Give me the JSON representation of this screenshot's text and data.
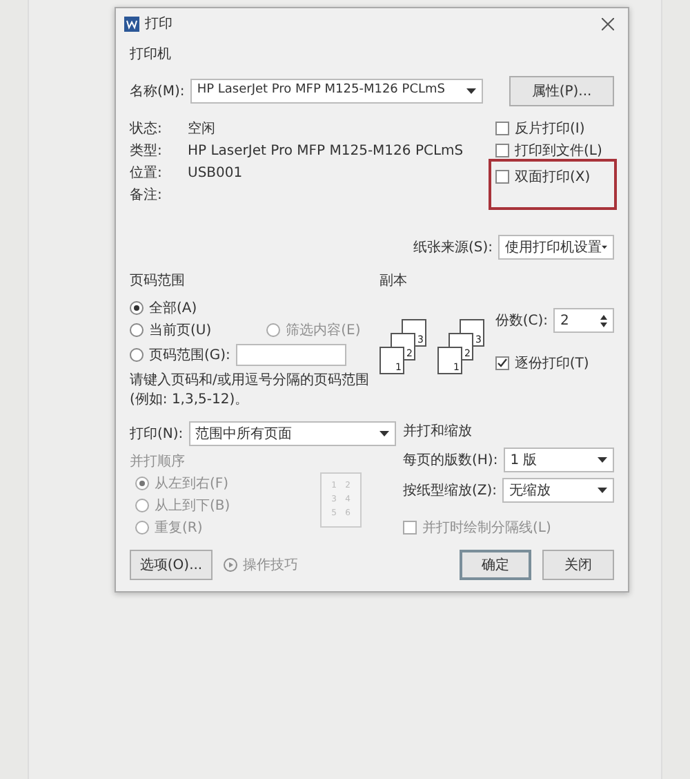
{
  "window": {
    "title": "打印"
  },
  "printer": {
    "heading": "打印机",
    "name_label": "名称(M):",
    "name_value": "HP LaserJet Pro MFP M125-M126 PCLmS",
    "properties_button": "属性(P)...",
    "info": [
      {
        "label": "状态:",
        "value": "空闲"
      },
      {
        "label": "类型:",
        "value": "HP LaserJet Pro MFP M125-M126 PCLmS"
      },
      {
        "label": "位置:",
        "value": "USB001"
      },
      {
        "label": "备注:"
      }
    ],
    "options": [
      {
        "label": "反片打印(I)",
        "checked": false,
        "highlighted": false
      },
      {
        "label": "打印到文件(L)",
        "checked": false,
        "highlighted": false
      },
      {
        "label": "双面打印(X)",
        "checked": false,
        "highlighted": true
      }
    ]
  },
  "paper_source": {
    "label": "纸张来源(S):",
    "value": "使用打印机设置"
  },
  "page_range": {
    "heading": "页码范围",
    "options": [
      {
        "kind": "radio",
        "label": "全部(A)",
        "selected": true,
        "disabled": false
      },
      {
        "kind": "radio",
        "label": "当前页(U)",
        "selected": false,
        "disabled": false
      },
      {
        "kind": "radio",
        "label": "筛选内容(E)",
        "selected": false,
        "disabled": true
      },
      {
        "kind": "input",
        "label": "页码范围(G):",
        "selected": false,
        "disabled": false
      }
    ],
    "hint": "请键入页码和/或用逗号分隔的页码范围(例如: 1,3,5-12)。"
  },
  "copies": {
    "heading": "副本",
    "stacks": [
      {
        "pages": [
          "1",
          "2",
          "3"
        ]
      },
      {
        "pages": [
          "1",
          "2",
          "3"
        ]
      }
    ],
    "count_label": "份数(C):",
    "count_value": "2",
    "collate": {
      "label": "逐份打印(T)",
      "checked": true
    }
  },
  "print": {
    "label": "打印(N):",
    "value": "范围中所有页面"
  },
  "order": {
    "heading": "并打顺序",
    "disabled": true,
    "options": [
      {
        "label": "从左到右(F)",
        "selected": true
      },
      {
        "label": "从上到下(B)",
        "selected": false
      },
      {
        "label": "重复(R)",
        "selected": false
      }
    ],
    "preview_pages": [
      "1",
      "2",
      "3",
      "4",
      "5",
      "6"
    ]
  },
  "zoom": {
    "heading": "并打和缩放",
    "per_page_label": "每页的版数(H):",
    "per_page_value": "1 版",
    "scale_label": "按纸型缩放(Z):",
    "scale_value": "无缩放",
    "separator": {
      "label": "并打时绘制分隔线(L)",
      "checked": false,
      "disabled": true
    }
  },
  "footer": {
    "options_button": "选项(O)...",
    "tips": {
      "label": "操作技巧",
      "disabled": true
    },
    "ok_button": "确定",
    "close_button": "关闭"
  }
}
